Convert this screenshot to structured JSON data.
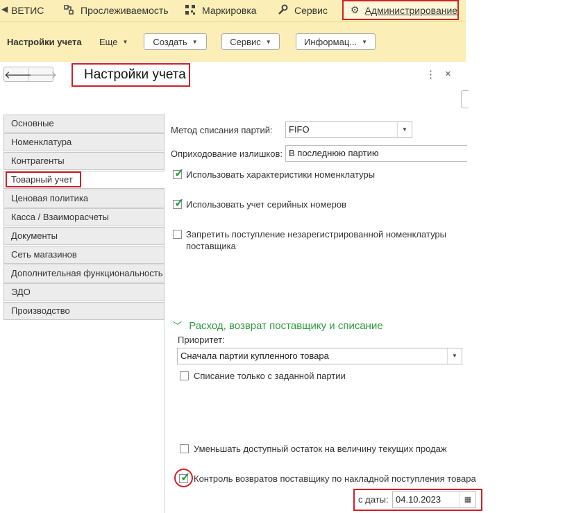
{
  "sections": {
    "vetis": "ВЕТИС",
    "traceability": "Прослеживаемость",
    "marking": "Маркировка",
    "service": "Сервис",
    "administration": "Администрирование"
  },
  "command_bar": {
    "title": "Настройки учета",
    "more": "Еще",
    "create": "Создать",
    "service": "Сервис",
    "info": "Информац..."
  },
  "form": {
    "title": "Настройки учета"
  },
  "tabs": [
    {
      "label": "Основные"
    },
    {
      "label": "Номенклатура"
    },
    {
      "label": "Контрагенты"
    },
    {
      "label": "Товарный учет"
    },
    {
      "label": "Ценовая политика"
    },
    {
      "label": "Касса / Взаиморасчеты"
    },
    {
      "label": "Документы"
    },
    {
      "label": "Сеть магазинов"
    },
    {
      "label": "Дополнительная функциональность"
    },
    {
      "label": "ЭДО"
    },
    {
      "label": "Производство"
    }
  ],
  "settings": {
    "write_off_method_label": "Метод списания партий:",
    "write_off_method_value": "FIFO",
    "surplus_label": "Оприходование излишков:",
    "surplus_value": "В последнюю партию",
    "use_characteristics": "Использовать характеристики номенклатуры",
    "use_serials": "Использовать учет серийных номеров",
    "forbid_unregistered": "Запретить поступление незарегистрированной номенклатуры поставщика",
    "group_title": "Расход, возврат поставщику и списание",
    "priority_label": "Приоритет:",
    "priority_value": "Сначала партии купленного товара",
    "write_off_given_batch": "Списание только с заданной партии",
    "reduce_available": "Уменьшать доступный остаток на величину текущих продаж",
    "control_returns": "Контроль возвратов поставщику по накладной поступления товара",
    "from_date_label": "с даты:",
    "from_date_value": "04.10.2023"
  },
  "checkboxes": {
    "use_characteristics": true,
    "use_serials": true,
    "forbid_unregistered": false,
    "write_off_given_batch": false,
    "reduce_available": false,
    "control_returns": true
  },
  "colors": {
    "panel_bg": "#fbeeb6",
    "highlight_red": "#d0202a",
    "group_green": "#2c9a3f",
    "check_green": "#1f9d3a"
  }
}
